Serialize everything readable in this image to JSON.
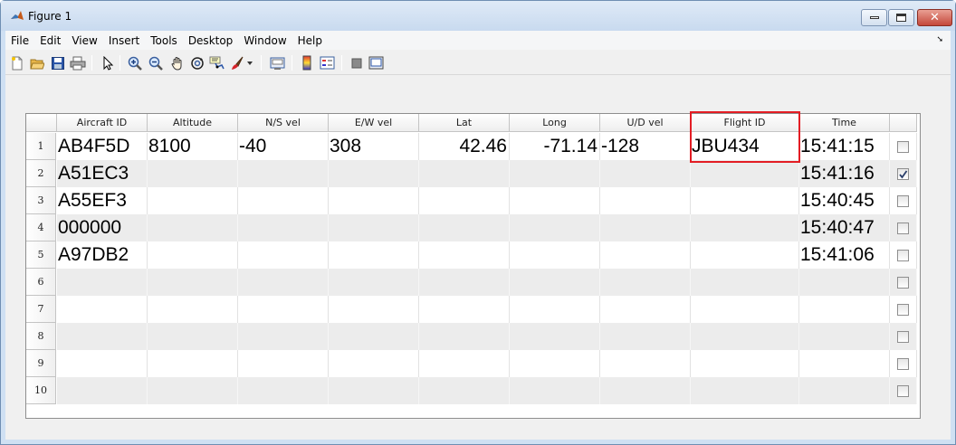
{
  "window": {
    "title": "Figure 1"
  },
  "menu": [
    "File",
    "Edit",
    "View",
    "Insert",
    "Tools",
    "Desktop",
    "Window",
    "Help"
  ],
  "toolbar": {
    "icons": [
      "new-figure-icon",
      "open-file-icon",
      "save-icon",
      "print-icon",
      "pointer-icon",
      "zoom-in-icon",
      "zoom-out-icon",
      "pan-icon",
      "rotate-3d-icon",
      "data-cursor-icon",
      "brush-icon",
      "brush-dropdown-icon",
      "link-plot-icon",
      "insert-colorbar-icon",
      "insert-legend-icon",
      "hide-plot-tools-icon",
      "show-plot-tools-icon"
    ]
  },
  "table": {
    "columns": [
      "Aircraft ID",
      "Altitude",
      "N/S vel",
      "E/W vel",
      "Lat",
      "Long",
      "U/D vel",
      "Flight ID",
      "Time",
      ""
    ],
    "rows": [
      {
        "num": "1",
        "cells": [
          "AB4F5D",
          "8100",
          "-40",
          "308",
          "42.46",
          "-71.14",
          "-128",
          "JBU434",
          "15:41:15"
        ],
        "checked": false
      },
      {
        "num": "2",
        "cells": [
          "A51EC3",
          "",
          "",
          "",
          "",
          "",
          "",
          "",
          "15:41:16"
        ],
        "checked": true
      },
      {
        "num": "3",
        "cells": [
          "A55EF3",
          "",
          "",
          "",
          "",
          "",
          "",
          "",
          "15:40:45"
        ],
        "checked": false
      },
      {
        "num": "4",
        "cells": [
          "000000",
          "",
          "",
          "",
          "",
          "",
          "",
          "",
          "15:40:47"
        ],
        "checked": false
      },
      {
        "num": "5",
        "cells": [
          "A97DB2",
          "",
          "",
          "",
          "",
          "",
          "",
          "",
          "15:41:06"
        ],
        "checked": false
      },
      {
        "num": "6",
        "cells": [
          "",
          "",
          "",
          "",
          "",
          "",
          "",
          "",
          ""
        ],
        "checked": false
      },
      {
        "num": "7",
        "cells": [
          "",
          "",
          "",
          "",
          "",
          "",
          "",
          "",
          ""
        ],
        "checked": false
      },
      {
        "num": "8",
        "cells": [
          "",
          "",
          "",
          "",
          "",
          "",
          "",
          "",
          ""
        ],
        "checked": false
      },
      {
        "num": "9",
        "cells": [
          "",
          "",
          "",
          "",
          "",
          "",
          "",
          "",
          ""
        ],
        "checked": false
      },
      {
        "num": "10",
        "cells": [
          "",
          "",
          "",
          "",
          "",
          "",
          "",
          "",
          ""
        ],
        "checked": false
      }
    ],
    "highlight_color": "#e31d24",
    "highlighted_column": "Flight ID"
  }
}
